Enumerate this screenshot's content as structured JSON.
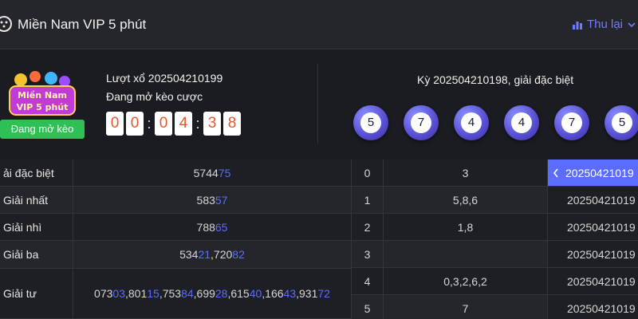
{
  "header": {
    "title": "Miền Nam VIP 5 phút",
    "history_label": "Thu lại"
  },
  "draw": {
    "badge_text": [
      "Miền Nam",
      "VIP 5 phút"
    ],
    "status": "Đang mở kèo",
    "round_text": "Lượt xổ 202504210199",
    "open_text": "Đang mở kèo cược",
    "timer_digits": [
      "0",
      "0",
      "0",
      "4",
      "3",
      "8"
    ]
  },
  "previous": {
    "title": "Kỳ 202504210198, giải đặc biệt",
    "balls": [
      "5",
      "7",
      "4",
      "4",
      "7",
      "5"
    ]
  },
  "results": [
    {
      "label": "ải đặc biệt",
      "parts": [
        {
          "t": "5744",
          "h": false
        },
        {
          "t": "75",
          "h": true
        }
      ]
    },
    {
      "label": "Giải nhất",
      "parts": [
        {
          "t": "583",
          "h": false
        },
        {
          "t": "57",
          "h": true
        }
      ]
    },
    {
      "label": "Giải nhì",
      "parts": [
        {
          "t": "788",
          "h": false
        },
        {
          "t": "65",
          "h": true
        }
      ]
    },
    {
      "label": "Giải ba",
      "parts": [
        {
          "t": "534",
          "h": false
        },
        {
          "t": "21",
          "h": true
        },
        {
          "t": ",720",
          "h": false
        },
        {
          "t": "82",
          "h": true
        }
      ]
    },
    {
      "label": "Giải tư",
      "parts": [
        {
          "t": "073",
          "h": false
        },
        {
          "t": "03",
          "h": true
        },
        {
          "t": ",801",
          "h": false
        },
        {
          "t": "15",
          "h": true
        },
        {
          "t": ",753",
          "h": false
        },
        {
          "t": "84",
          "h": true
        },
        {
          "t": ",699",
          "h": false
        },
        {
          "t": "28",
          "h": true
        },
        {
          "t": ",615",
          "h": false
        },
        {
          "t": "40",
          "h": true
        },
        {
          "t": ",166",
          "h": false
        },
        {
          "t": "43",
          "h": true
        },
        {
          "t": ",931",
          "h": false
        },
        {
          "t": "72",
          "h": true
        }
      ]
    }
  ],
  "head_tail": [
    {
      "k": "0",
      "v": "3"
    },
    {
      "k": "1",
      "v": "5,8,6"
    },
    {
      "k": "2",
      "v": "1,8"
    },
    {
      "k": "3",
      "v": ""
    },
    {
      "k": "4",
      "v": "0,3,2,6,2"
    },
    {
      "k": "5",
      "v": "7"
    }
  ],
  "history": [
    {
      "text": "20250421019",
      "active": true
    },
    {
      "text": "20250421019",
      "active": false
    },
    {
      "text": "20250421019",
      "active": false
    },
    {
      "text": "20250421019",
      "active": false
    },
    {
      "text": "20250421019",
      "active": false
    },
    {
      "text": "20250421019",
      "active": false
    }
  ],
  "colors": {
    "accent": "#5b6cff",
    "status_green": "#2ebf55",
    "timer_digit": "#e4572e",
    "ball": "#5a52d6"
  }
}
